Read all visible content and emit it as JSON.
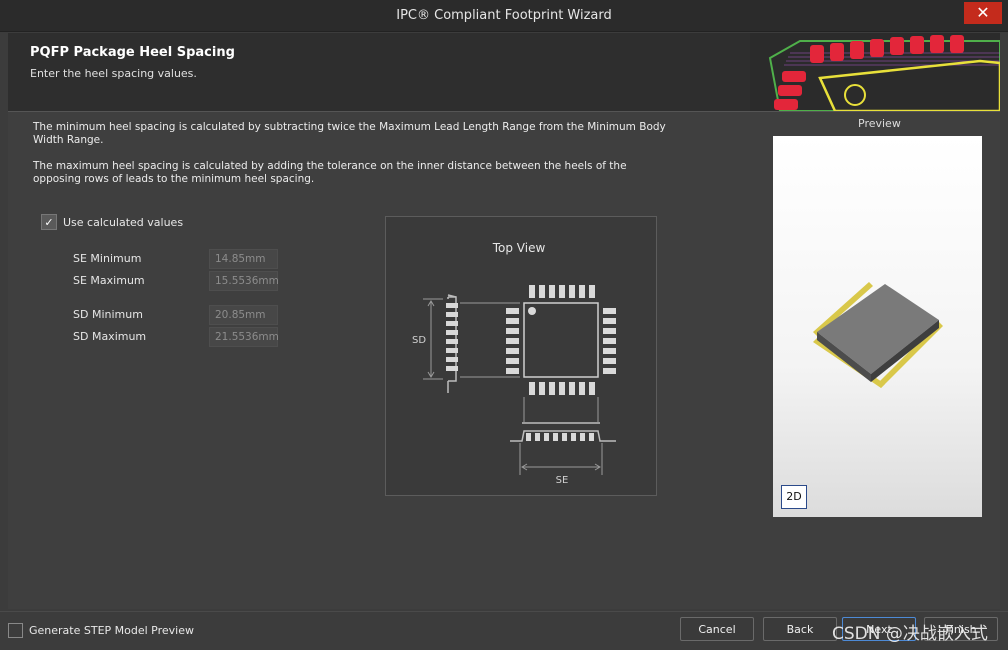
{
  "window": {
    "title": "IPC® Compliant Footprint Wizard",
    "close_glyph": "✕"
  },
  "header": {
    "title": "PQFP Package Heel Spacing",
    "subtitle": "Enter the heel spacing values."
  },
  "description": {
    "line1": "The minimum heel spacing is calculated by subtracting twice the Maximum Lead Length Range from the Minimum Body Width Range.",
    "line2": "The maximum heel spacing is calculated by adding the tolerance on the inner distance between the heels of the opposing rows of leads to the minimum heel spacing."
  },
  "options": {
    "use_calculated_label": "Use calculated values",
    "use_calculated_checked": true
  },
  "fields": {
    "se_min": {
      "label": "SE Minimum",
      "value": "14.85mm"
    },
    "se_max": {
      "label": "SE Maximum",
      "value": "15.5536mm"
    },
    "sd_min": {
      "label": "SD Minimum",
      "value": "20.85mm"
    },
    "sd_max": {
      "label": "SD Maximum",
      "value": "21.5536mm"
    }
  },
  "diagram": {
    "title": "Top View",
    "sd_label": "SD",
    "se_label": "SE"
  },
  "preview": {
    "label": "Preview",
    "mode_button": "2D"
  },
  "footer": {
    "step_preview_label": "Generate STEP Model Preview",
    "step_preview_checked": false,
    "cancel": "Cancel",
    "back": "Back",
    "next": "Next",
    "finish": "Finish"
  },
  "watermark": "CSDN @决战嵌入式",
  "colors": {
    "background": "#3c3c3c",
    "header": "#2e2e2e",
    "close_red": "#c42b1c",
    "pcb_red": "#e3263a",
    "pcb_yellow": "#e8e03a",
    "pcb_green": "#4fb04a",
    "primary_border": "#4d8ad6"
  },
  "icons": [
    "close-icon",
    "checkmark-icon"
  ]
}
